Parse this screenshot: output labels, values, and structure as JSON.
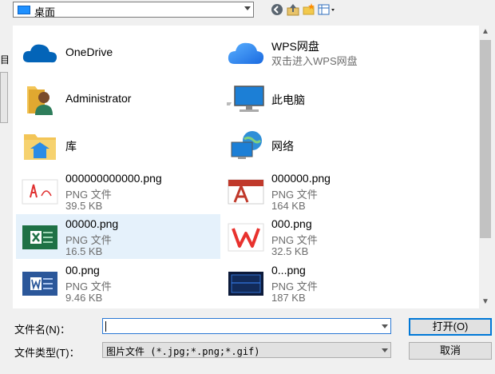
{
  "toolbar": {
    "look_in": "桌面",
    "icons": [
      "back-icon",
      "up-folder-icon",
      "new-folder-icon",
      "view-menu-icon"
    ]
  },
  "left_partial_label": "目",
  "items": [
    {
      "name": "OneDrive",
      "line2": "",
      "line3": "",
      "icon": "onedrive-cloud-icon"
    },
    {
      "name": "WPS网盘",
      "line2": "双击进入WPS网盘",
      "line3": "",
      "icon": "wps-cloud-icon"
    },
    {
      "name": "Administrator",
      "line2": "",
      "line3": "",
      "icon": "user-folder-icon"
    },
    {
      "name": "此电脑",
      "line2": "",
      "line3": "",
      "icon": "computer-icon"
    },
    {
      "name": "库",
      "line2": "",
      "line3": "",
      "icon": "library-folder-icon"
    },
    {
      "name": "网络",
      "line2": "",
      "line3": "",
      "icon": "network-icon"
    },
    {
      "name": "000000000000.png",
      "line2": "PNG 文件",
      "line3": "39.5 KB",
      "icon": "pdf-thumbnail-icon"
    },
    {
      "name": "000000.png",
      "line2": "PNG 文件",
      "line3": "164 KB",
      "icon": "autocad-thumbnail-icon"
    },
    {
      "name": "00000.png",
      "line2": "PNG 文件",
      "line3": "16.5 KB",
      "icon": "excel-thumbnail-icon",
      "selected": true
    },
    {
      "name": "000.png",
      "line2": "PNG 文件",
      "line3": "32.5 KB",
      "icon": "wps-logo-thumbnail-icon"
    },
    {
      "name": "00.png",
      "line2": "PNG 文件",
      "line3": "9.46 KB",
      "icon": "word-thumbnail-icon"
    },
    {
      "name": "0...png",
      "line2": "PNG 文件",
      "line3": "187 KB",
      "icon": "dark-screenshot-thumbnail-icon"
    }
  ],
  "bottom": {
    "filename_label": "文件名(N)：",
    "filename_value": "",
    "filetype_label": "文件类型(T)：",
    "filetype_value": "图片文件 (*.jpg;*.png;*.gif)",
    "open_button": "打开(O)",
    "cancel_button": "取消"
  },
  "colors": {
    "selection": "#e5f1fb",
    "accent": "#0078d7"
  }
}
